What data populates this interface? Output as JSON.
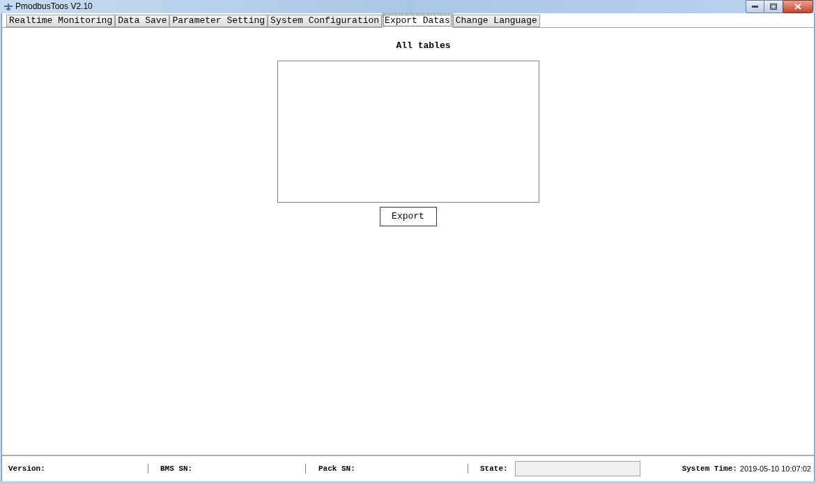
{
  "window": {
    "title": "PmodbusToos V2.10"
  },
  "tabs": [
    {
      "label": "Realtime Monitoring",
      "selected": false
    },
    {
      "label": "Data Save",
      "selected": false
    },
    {
      "label": "Parameter Setting",
      "selected": false
    },
    {
      "label": "System Configuration",
      "selected": false
    },
    {
      "label": "Export Datas",
      "selected": true
    },
    {
      "label": "Change Language",
      "selected": false
    }
  ],
  "export_panel": {
    "title": "All tables",
    "button": "Export"
  },
  "status_bar": {
    "version_label": "Version:",
    "bms_sn_label": "BMS SN:",
    "pack_sn_label": "Pack SN:",
    "state_label": "State:",
    "system_time_label": "System Time:",
    "system_time": "2019-05-10 10:07:02"
  }
}
